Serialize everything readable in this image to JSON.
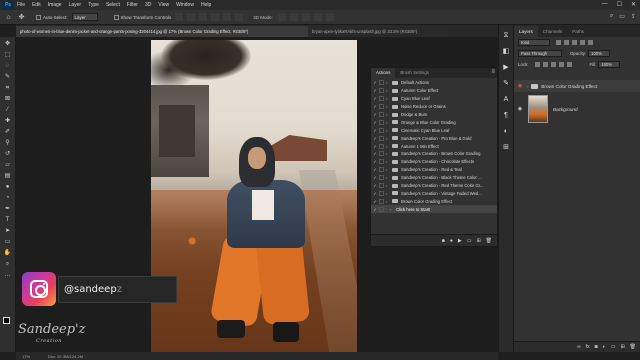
{
  "app": {
    "logo_text": "Ps",
    "menu": [
      "File",
      "Edit",
      "Image",
      "Layer",
      "Type",
      "Select",
      "Filter",
      "3D",
      "View",
      "Window",
      "Help"
    ],
    "window_controls": [
      "—",
      "☐",
      "✕"
    ]
  },
  "options": {
    "auto_select_label": "Auto-Select:",
    "auto_select_value": "Layer",
    "transform_label": "Show Transform Controls",
    "mode_3d_label": "3D Mode:"
  },
  "tabs": [
    {
      "label": "photo-of-women-in-blue-denim-jacket-and-orange-pants-posing-3204414.jpg @ 17% (Brown Color Grading Effect, RGB/8*)",
      "active": true
    },
    {
      "label": "bryan-apen-lybkaRAkf4-unsplash.jpg @ 33.2% (RGB/8*)",
      "active": false
    }
  ],
  "actions_panel": {
    "tabs": [
      "Actions",
      "Brush Settings"
    ],
    "items": [
      {
        "label": "Default Actions",
        "level": 0,
        "highlight": false
      },
      {
        "label": "Autumn Color Effect",
        "level": 0,
        "highlight": false
      },
      {
        "label": "Cyan Blue Leaf",
        "level": 0,
        "highlight": false
      },
      {
        "label": "Noise Reduce or Grains",
        "level": 0,
        "highlight": false
      },
      {
        "label": "Dodge & Burn",
        "level": 0,
        "highlight": false
      },
      {
        "label": "Orange & Blue Color Grading",
        "level": 0,
        "highlight": false
      },
      {
        "label": "Cinematic Cyan Blue Leaf",
        "level": 0,
        "highlight": false
      },
      {
        "label": "Sandeep's Creation - Pro Blue & Gold",
        "level": 0,
        "highlight": false
      },
      {
        "label": "Autumn 1 Min Effect",
        "level": 0,
        "highlight": false
      },
      {
        "label": "Sandeep's Creation - Brown Color Grading",
        "level": 0,
        "highlight": false
      },
      {
        "label": "Sandeep's Creation - Chocolate Effects",
        "level": 0,
        "highlight": false
      },
      {
        "label": "Sandeep's Creation - Red & Teal",
        "level": 0,
        "highlight": false
      },
      {
        "label": "Sandeep's Creation - Black Theme Color ...",
        "level": 0,
        "highlight": false
      },
      {
        "label": "Sandeep's Creation - Red Theme Color Gr...",
        "level": 0,
        "highlight": false
      },
      {
        "label": "Sandeep's Creation - Vintage Faded Wed...",
        "level": 0,
        "highlight": false
      },
      {
        "label": "Brown Color Grading Effect",
        "level": 0,
        "highlight": false
      },
      {
        "label": "Click here to Start!",
        "level": 1,
        "highlight": true
      }
    ],
    "bottom_icons": [
      "stop",
      "record",
      "play",
      "folder",
      "new",
      "delete"
    ]
  },
  "layers_panel": {
    "tabs": [
      "Layers",
      "Channels",
      "Paths"
    ],
    "filter_label": "Kind",
    "blend_mode": "Pass Through",
    "opacity_label": "Opacity:",
    "opacity_value": "100%",
    "lock_label": "Lock:",
    "fill_label": "Fill:",
    "fill_value": "100%",
    "layers": [
      {
        "name": "Brown Color Grading Effect",
        "type": "group",
        "eye_color": "#e35252"
      },
      {
        "name": "Background",
        "type": "image",
        "eye_color": "#cfcfcf"
      }
    ],
    "footer_icons": [
      "link",
      "fx",
      "mask",
      "adjustment",
      "group",
      "new",
      "delete"
    ]
  },
  "status": {
    "zoom": "17%",
    "doc": "Doc: 57.3M/124.2M"
  },
  "overlay": {
    "instagram_handle_main": "@sandeep",
    "instagram_handle_tail": "z",
    "watermark": "Sandeep'z",
    "watermark_small": "Creation"
  }
}
